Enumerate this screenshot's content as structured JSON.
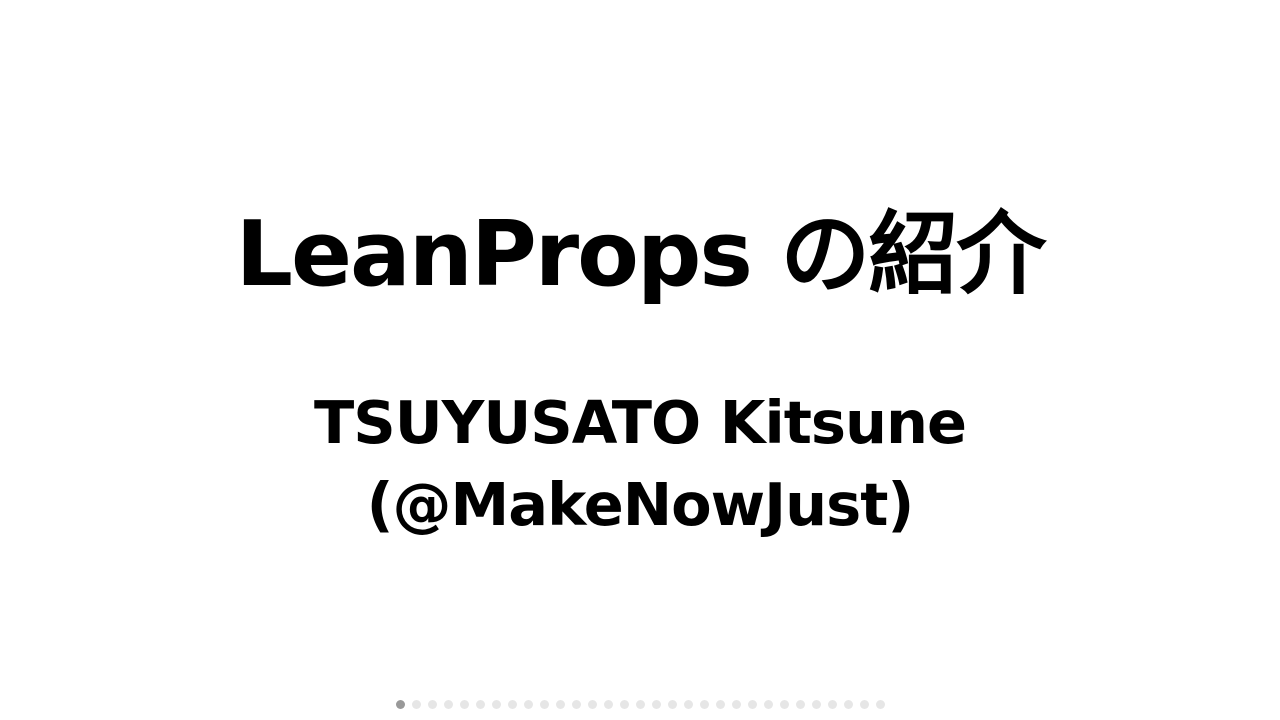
{
  "slide": {
    "title": "LeanProps の紹介",
    "author_name": "TSUYUSATO Kitsune",
    "author_handle": "(@MakeNowJust)"
  },
  "slide_indicator": {
    "total": 31,
    "current": 1,
    "active_color": "#999999",
    "inactive_color": "#e6e6e6"
  }
}
